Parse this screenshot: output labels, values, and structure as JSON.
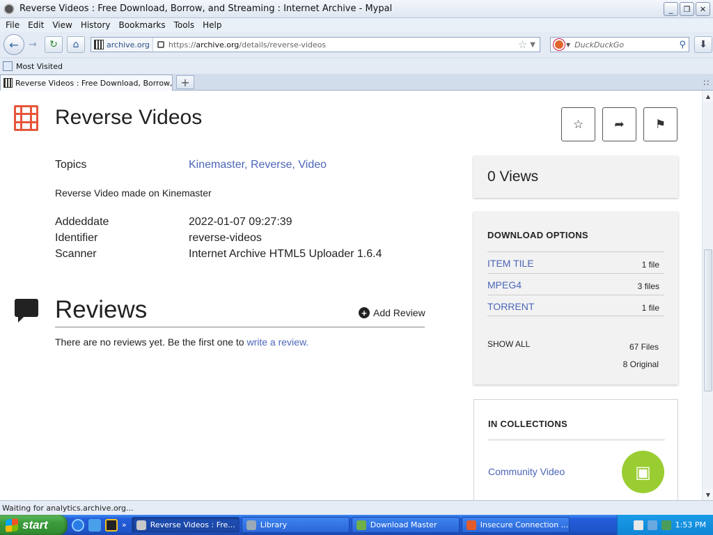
{
  "window": {
    "title": "Reverse Videos : Free Download, Borrow, and Streaming : Internet Archive - Mypal",
    "minimize": "_",
    "maximize": "❐",
    "close": "✕"
  },
  "menu": {
    "file": "File",
    "edit": "Edit",
    "view": "View",
    "history": "History",
    "bookmarks": "Bookmarks",
    "tools": "Tools",
    "help": "Help"
  },
  "navbar": {
    "site_name": "archive.org",
    "url_prefix": "https://",
    "url_host": "archive.org",
    "url_path": "/details/reverse-videos",
    "search_placeholder": "DuckDuckGo"
  },
  "bookmarks_bar": {
    "most_visited": "Most Visited"
  },
  "tabs": {
    "active_label": "Reverse Videos : Free Download, Borrow, a...",
    "new_tab": "+"
  },
  "item": {
    "title": "Reverse Videos",
    "topics_label": "Topics",
    "topics": [
      "Kinemaster",
      "Reverse",
      "Video"
    ],
    "description": "Reverse Video made on Kinemaster",
    "metadata": [
      {
        "label": "Addeddate",
        "value": "2022-01-07 09:27:39"
      },
      {
        "label": "Identifier",
        "value": "reverse-videos"
      },
      {
        "label": "Scanner",
        "value": "Internet Archive HTML5 Uploader 1.6.4"
      }
    ]
  },
  "reviews": {
    "title": "Reviews",
    "add_label": "Add Review",
    "empty_text": "There are no reviews yet. Be the first one to ",
    "empty_link": "write a review."
  },
  "sidebar": {
    "views": "0 Views",
    "download_heading": "DOWNLOAD OPTIONS",
    "formats": [
      {
        "name": "ITEM TILE",
        "count": "1 file"
      },
      {
        "name": "MPEG4",
        "count": "3 files"
      },
      {
        "name": "TORRENT",
        "count": "1 file"
      }
    ],
    "show_all": "SHOW ALL",
    "total_files": "67 Files",
    "original_files": "8 Original",
    "collections_heading": "IN COLLECTIONS",
    "collection": "Community Video"
  },
  "status": {
    "text": "Waiting for analytics.archive.org..."
  },
  "taskbar": {
    "start": "start",
    "tasks": [
      {
        "label": "Reverse Videos : Fre...",
        "color": "#c8c8c8"
      },
      {
        "label": "Library",
        "color": "#9aa8b8"
      },
      {
        "label": "Download Master",
        "color": "#6fb04a"
      },
      {
        "label": "Insecure Connection ...",
        "color": "#e25b2a"
      }
    ],
    "clock": "1:53 PM"
  },
  "colors": {
    "accent_link": "#4b65b8",
    "film_icon": "#e6563a",
    "collection_avatar": "#9acd32"
  }
}
